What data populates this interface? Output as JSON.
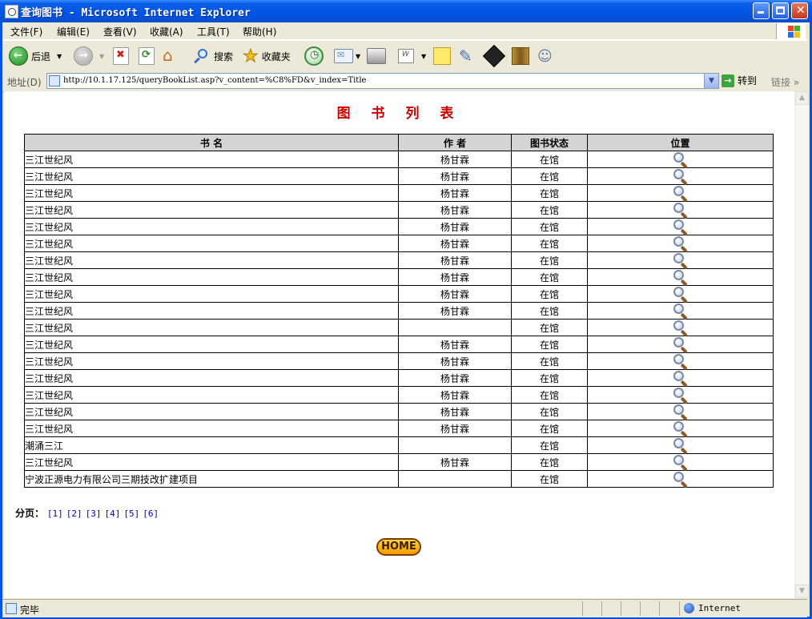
{
  "window": {
    "title": "查询图书 - Microsoft Internet Explorer"
  },
  "menu": [
    "文件(F)",
    "编辑(E)",
    "查看(V)",
    "收藏(A)",
    "工具(T)",
    "帮助(H)"
  ],
  "toolbar": {
    "back": "后退",
    "search": "搜索",
    "favorites": "收藏夹"
  },
  "address": {
    "label": "地址(D)",
    "url": "http://10.1.17.125/queryBookList.asp?v_content=%C8%FD&v_index=Title",
    "go": "转到",
    "links": "链接"
  },
  "page": {
    "title": "图 书 列 表",
    "columns": [
      "书 名",
      "作 者",
      "图书状态",
      "位置"
    ],
    "rows": [
      {
        "title": "三江世纪风",
        "author": "杨甘霖",
        "status": "在馆"
      },
      {
        "title": "三江世纪风",
        "author": "杨甘霖",
        "status": "在馆"
      },
      {
        "title": "三江世纪风",
        "author": "杨甘霖",
        "status": "在馆"
      },
      {
        "title": "三江世纪风",
        "author": "杨甘霖",
        "status": "在馆"
      },
      {
        "title": "三江世纪风",
        "author": "杨甘霖",
        "status": "在馆"
      },
      {
        "title": "三江世纪风",
        "author": "杨甘霖",
        "status": "在馆"
      },
      {
        "title": "三江世纪风",
        "author": "杨甘霖",
        "status": "在馆"
      },
      {
        "title": "三江世纪风",
        "author": "杨甘霖",
        "status": "在馆"
      },
      {
        "title": "三江世纪风",
        "author": "杨甘霖",
        "status": "在馆"
      },
      {
        "title": "三江世纪风",
        "author": "杨甘霖",
        "status": "在馆"
      },
      {
        "title": "三江世纪风",
        "author": "",
        "status": "在馆"
      },
      {
        "title": "三江世纪风",
        "author": "杨甘霖",
        "status": "在馆"
      },
      {
        "title": "三江世纪风",
        "author": "杨甘霖",
        "status": "在馆"
      },
      {
        "title": "三江世纪风",
        "author": "杨甘霖",
        "status": "在馆"
      },
      {
        "title": "三江世纪风",
        "author": "杨甘霖",
        "status": "在馆"
      },
      {
        "title": "三江世纪风",
        "author": "杨甘霖",
        "status": "在馆"
      },
      {
        "title": "三江世纪风",
        "author": "杨甘霖",
        "status": "在馆"
      },
      {
        "title": "潮涌三江",
        "author": "",
        "status": "在馆"
      },
      {
        "title": "三江世纪风",
        "author": "杨甘霖",
        "status": "在馆"
      },
      {
        "title": "宁波正源电力有限公司三期技改扩建项目",
        "author": "",
        "status": "在馆"
      }
    ],
    "pager_label": "分页：",
    "pages": [
      "[1]",
      "[2]",
      "[3]",
      "[4]",
      "[5]",
      "[6]"
    ],
    "home": "HOME"
  },
  "status": {
    "text": "完毕",
    "zone": "Internet"
  }
}
